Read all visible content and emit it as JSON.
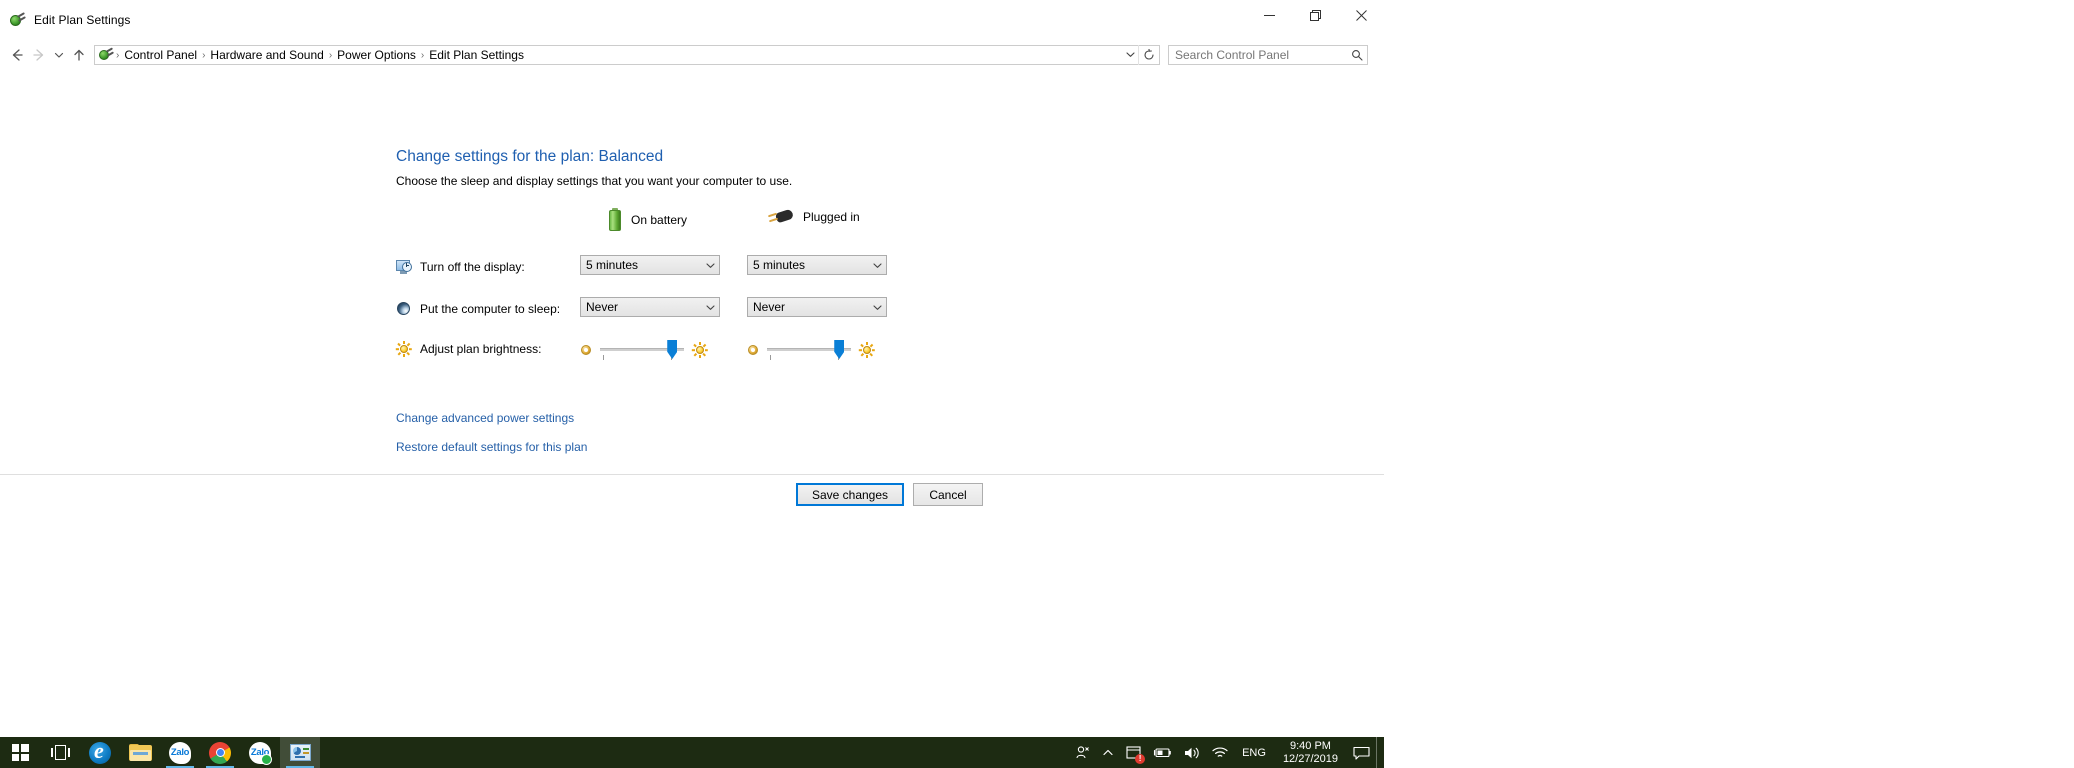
{
  "window": {
    "title": "Edit Plan Settings",
    "app_icon": "power-plug-icon",
    "controls": {
      "minimize": "minimize-icon",
      "maximize": "restore-icon",
      "close": "close-icon"
    }
  },
  "addressbar": {
    "back": "back-arrow-icon",
    "forward": "forward-arrow-icon",
    "recent": "recent-locations-chevron-icon",
    "up": "up-arrow-icon",
    "breadcrumbs": [
      "Control Panel",
      "Hardware and Sound",
      "Power Options",
      "Edit Plan Settings"
    ],
    "separator": "›",
    "dropdown": "⌄",
    "refresh": "refresh-icon"
  },
  "search": {
    "placeholder": "Search Control Panel",
    "value": "",
    "icon": "search-icon"
  },
  "page": {
    "title": "Change settings for the plan: Balanced",
    "subtitle": "Choose the sleep and display settings that you want your computer to use."
  },
  "columns": [
    {
      "label": "On battery",
      "icon": "battery-icon"
    },
    {
      "label": "Plugged in",
      "icon": "power-plug-icon"
    }
  ],
  "settings": [
    {
      "label": "Turn off the display:",
      "icon": "display-clock-icon",
      "battery_value": "5 minutes",
      "plugged_value": "5 minutes"
    },
    {
      "label": "Put the computer to sleep:",
      "icon": "sleep-moon-icon",
      "battery_value": "Never",
      "plugged_value": "Never"
    }
  ],
  "brightness": {
    "label": "Adjust plan brightness:",
    "icon": "sun-icon",
    "low_icon": "dim-brightness-icon",
    "high_icon": "bright-brightness-icon",
    "battery_percent": 86,
    "plugged_percent": 86
  },
  "links": [
    "Change advanced power settings",
    "Restore default settings for this plan"
  ],
  "buttons": {
    "save": "Save changes",
    "cancel": "Cancel"
  },
  "taskbar": {
    "items": [
      {
        "name": "start-button",
        "icon": "windows-logo-icon"
      },
      {
        "name": "task-view-button",
        "icon": "task-view-icon"
      },
      {
        "name": "edge-button",
        "icon": "edge-icon"
      },
      {
        "name": "file-explorer-button",
        "icon": "folder-icon"
      },
      {
        "name": "zalo-button",
        "icon": "zalo-icon",
        "label": "Zalo"
      },
      {
        "name": "chrome-button",
        "icon": "chrome-icon"
      },
      {
        "name": "zalo-video-button",
        "icon": "zalo-video-icon",
        "label": "Zalo"
      },
      {
        "name": "control-panel-button",
        "icon": "control-panel-icon"
      }
    ],
    "tray": {
      "people": "people-icon",
      "chevron": "show-hidden-icons-chevron",
      "action_center": "action-center-icon",
      "action_center_badge": "!",
      "battery": "battery-tray-icon",
      "volume": "speaker-icon",
      "network": "wifi-icon",
      "language": "ENG",
      "time": "9:40 PM",
      "date": "12/27/2019",
      "notifications": "notification-icon"
    }
  },
  "colors": {
    "title_blue": "#1f5fb0",
    "link_blue": "#2660a8",
    "accent": "#0078d7",
    "slider": "#0a7fd6",
    "taskbar_bg": "#1d2b12",
    "badge_red": "#e03a2f"
  }
}
